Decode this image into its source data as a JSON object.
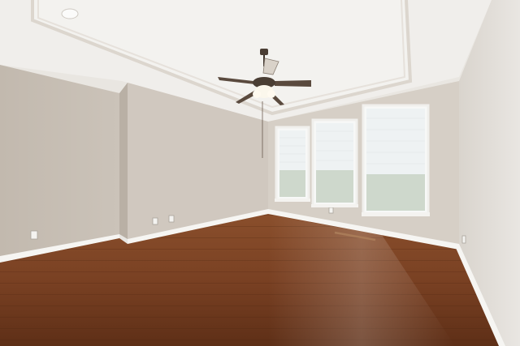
{
  "scene": {
    "kind": "photo",
    "subject": "empty-room-interior",
    "colors": {
      "ceiling": "#f1efec",
      "tray": "#ece8e3",
      "wall_left": "#c8c0b6",
      "wall_mid": "#d3ccc3",
      "wall_back": "#d8d1c8",
      "wall_right": "#e4e0db",
      "baseboard": "#f7f6f3",
      "floor_light": "#9a5a34",
      "floor_dark": "#5e2f17",
      "window_glass": "#f4f7f8",
      "fan_blade": "#5a4a3e"
    },
    "objects": [
      {
        "name": "ceiling-fan",
        "icon": "fan-icon"
      },
      {
        "name": "smoke-detector",
        "icon": "circle-icon"
      },
      {
        "name": "window-left"
      },
      {
        "name": "window-center"
      },
      {
        "name": "window-right"
      },
      {
        "name": "hardwood-floor"
      },
      {
        "name": "electrical-outlet",
        "count": 4
      }
    ]
  }
}
